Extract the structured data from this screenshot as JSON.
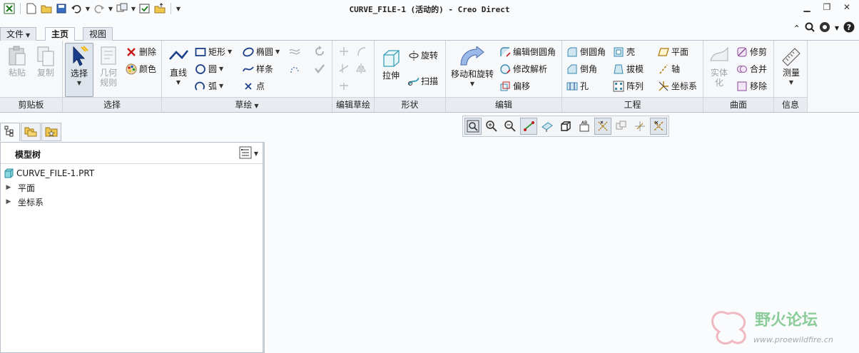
{
  "window": {
    "title": "CURVE_FILE-1 (活动的) - Creo Direct"
  },
  "menu_tabs": [
    {
      "label": "文件",
      "has_dropdown": true
    },
    {
      "label": "主页",
      "active": true
    },
    {
      "label": "视图"
    }
  ],
  "ribbon": {
    "groups": {
      "clipboard": {
        "label": "剪贴板",
        "paste": "粘贴",
        "copy": "复制"
      },
      "select": {
        "label": "选择",
        "select": "选择",
        "geometry_rules": "几何\n规则",
        "delete": "删除",
        "color": "颜色"
      },
      "sketch": {
        "label": "草绘",
        "line": "直线",
        "rectangle": "矩形",
        "circle": "圆",
        "arc": "弧",
        "ellipse": "椭圆",
        "spline": "样条",
        "point": "点"
      },
      "edit_sketch": {
        "label": "编辑草绘"
      },
      "shape": {
        "label": "形状",
        "extrude": "拉伸",
        "revolve": "旋转",
        "sweep": "扫描"
      },
      "edit": {
        "label": "编辑",
        "move_rotate": "移动和旋转",
        "edit_round": "编辑倒圆角",
        "modify_analytic": "修改解析",
        "offset": "偏移"
      },
      "engineering": {
        "label": "工程",
        "round": "倒圆角",
        "chamfer": "倒角",
        "hole": "孔",
        "shell": "壳",
        "draft": "拔模",
        "pattern": "阵列",
        "plane": "平面",
        "axis": "轴",
        "csys": "坐标系"
      },
      "surface": {
        "label": "曲面",
        "solidify": "实体\n化",
        "trim": "修剪",
        "merge": "合并",
        "remove": "移除"
      },
      "info": {
        "label": "信息",
        "measure": "测量"
      }
    }
  },
  "model_tree": {
    "title": "模型树",
    "items": [
      {
        "label": "CURVE_FILE-1.PRT",
        "type": "part"
      },
      {
        "label": "平面",
        "type": "folder"
      },
      {
        "label": "坐标系",
        "type": "folder"
      }
    ]
  },
  "watermark": {
    "text": "野火论坛",
    "url": "www.proewildfire.cn"
  },
  "colors": {
    "accent": "#1a5aa8",
    "ribbon_bg": "#f7f8fa",
    "group_label_bg": "#e8ecf1"
  }
}
